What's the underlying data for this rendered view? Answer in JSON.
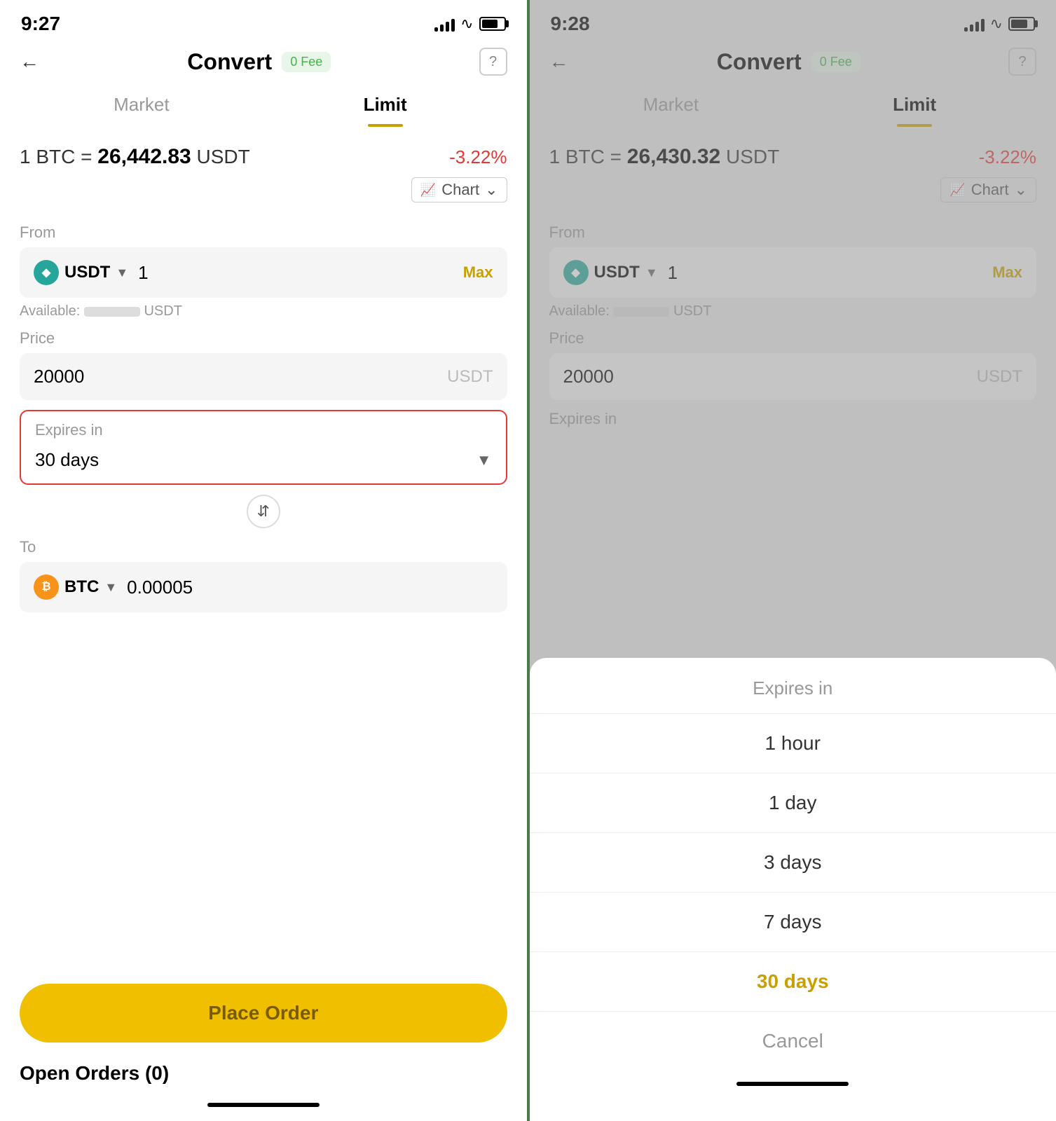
{
  "left": {
    "status": {
      "time": "9:27",
      "battery_level": "75"
    },
    "nav": {
      "title": "Convert",
      "fee_label": "0 Fee",
      "help_icon": "?"
    },
    "tabs": [
      {
        "label": "Market",
        "active": false
      },
      {
        "label": "Limit",
        "active": true
      }
    ],
    "price": {
      "base": "1 BTC =",
      "value": "26,442.83",
      "quote": "USDT",
      "change": "-3.22%"
    },
    "chart_label": "Chart",
    "from": {
      "label": "From",
      "currency": "USDT",
      "value": "1",
      "max_label": "Max",
      "available_label": "Available:",
      "available_unit": "USDT"
    },
    "price_field": {
      "label": "Price",
      "value": "20000",
      "unit": "USDT"
    },
    "expires": {
      "label": "Expires in",
      "value": "30 days"
    },
    "to": {
      "label": "To",
      "currency": "BTC",
      "value": "0.00005"
    },
    "place_order": "Place Order",
    "open_orders": "Open Orders (0)"
  },
  "right": {
    "status": {
      "time": "9:28"
    },
    "nav": {
      "title": "Convert",
      "fee_label": "0 Fee",
      "help_icon": "?"
    },
    "tabs": [
      {
        "label": "Market",
        "active": false
      },
      {
        "label": "Limit",
        "active": true
      }
    ],
    "price": {
      "base": "1 BTC =",
      "value": "26,430.32",
      "quote": "USDT",
      "change": "-3.22%"
    },
    "chart_label": "Chart",
    "from": {
      "label": "From",
      "currency": "USDT",
      "value": "1",
      "max_label": "Max",
      "available_label": "Available:",
      "available_unit": "USDT"
    },
    "price_field": {
      "label": "Price",
      "value": "20000",
      "unit": "USDT"
    },
    "expires": {
      "label": "Expires in"
    },
    "sheet": {
      "title": "Expires in",
      "options": [
        {
          "label": "1 hour",
          "selected": false
        },
        {
          "label": "1 day",
          "selected": false
        },
        {
          "label": "3 days",
          "selected": false
        },
        {
          "label": "7 days",
          "selected": false
        },
        {
          "label": "30 days",
          "selected": true
        },
        {
          "label": "Cancel",
          "cancel": true
        }
      ]
    }
  }
}
